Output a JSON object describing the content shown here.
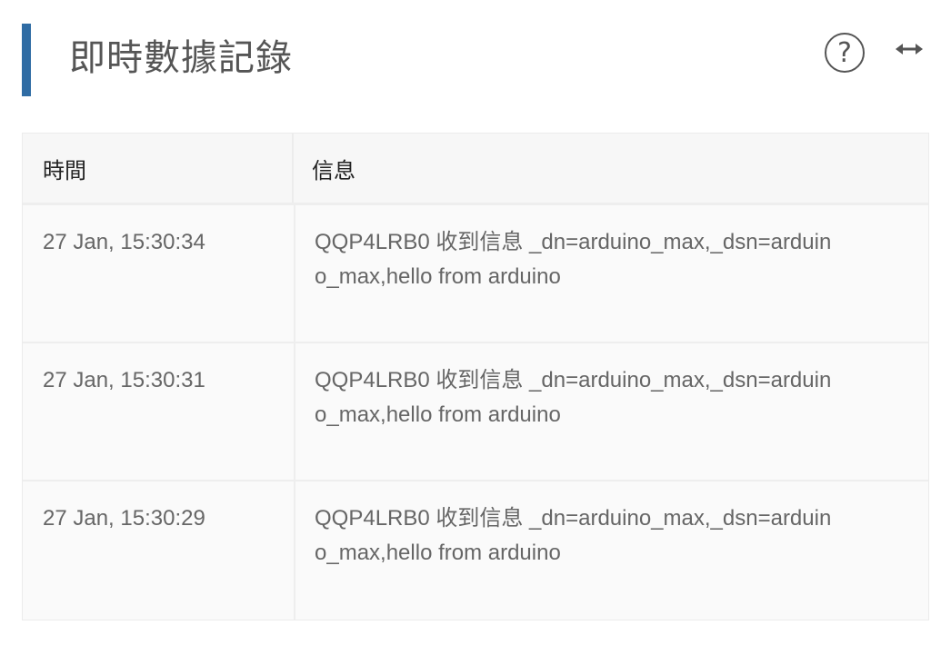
{
  "header": {
    "title": "即時數據記錄",
    "help_icon": "question-circle-icon",
    "help_symbol": "?",
    "expand_icon": "arrows-horizontal-icon",
    "accent_color": "#2f6ca4"
  },
  "table": {
    "columns": [
      "時間",
      "信息"
    ],
    "rows": [
      {
        "time": "27 Jan, 15:30:34",
        "message": "QQP4LRB0 收到信息 _dn=arduino_max,_dsn=arduino_max,hello from arduino"
      },
      {
        "time": "27 Jan, 15:30:31",
        "message": "QQP4LRB0 收到信息 _dn=arduino_max,_dsn=arduino_max,hello from arduino"
      },
      {
        "time": "27 Jan, 15:30:29",
        "message": "QQP4LRB0 收到信息 _dn=arduino_max,_dsn=arduino_max,hello from arduino"
      }
    ]
  }
}
